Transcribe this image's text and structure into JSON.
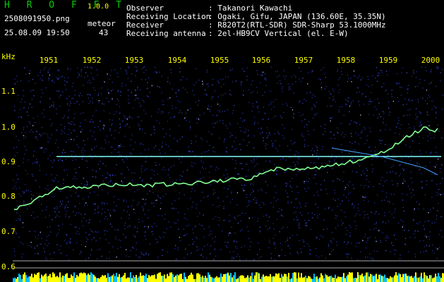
{
  "app": {
    "name": "H R O F F T",
    "version": "1.0.0"
  },
  "file": {
    "name": "2508091950.png",
    "datetime": "25.08.09 19:50"
  },
  "counter": {
    "label": "meteor",
    "value": "43"
  },
  "station": [
    {
      "label": "Observer",
      "value": ": Takanori Kawachi"
    },
    {
      "label": "Receiving Location",
      "value": ": Ogaki, Gifu, JAPAN (136.60E, 35.35N)"
    },
    {
      "label": "Receiver",
      "value": ": R820T2(RTL-SDR) SDR-Sharp 53.1000MHz"
    },
    {
      "label": "Receiving antenna",
      "value": ": 2el-HB9CV Vertical (el. E-W)"
    }
  ],
  "axis": {
    "unit": "kHz",
    "time_ticks": [
      "1951",
      "1952",
      "1953",
      "1954",
      "1955",
      "1956",
      "1957",
      "1958",
      "1959",
      "2000"
    ],
    "freq_ticks": [
      "1.1",
      "1.0",
      "0.9",
      "0.8",
      "0.7",
      "0.6"
    ],
    "freq_values": [
      1.1,
      1.0,
      0.9,
      0.8,
      0.7,
      0.6
    ]
  },
  "colors": {
    "title": "#00d000",
    "text": "#ffff00",
    "background": "#000000",
    "noise": "#3040c0",
    "signal": "#80ffc0"
  }
}
